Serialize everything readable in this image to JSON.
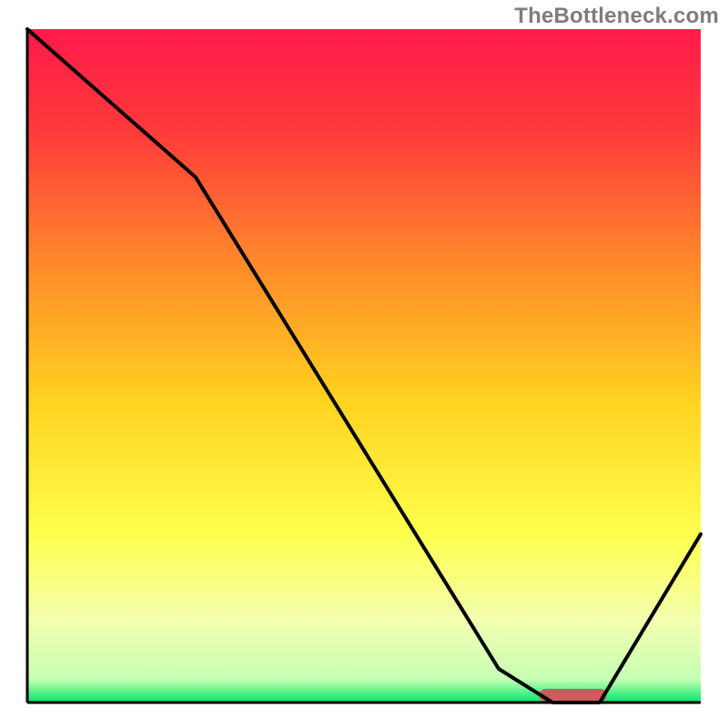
{
  "watermark": "TheBottleneck.com",
  "chart_data": {
    "type": "line",
    "title": "",
    "xlabel": "",
    "ylabel": "",
    "xlim": [
      0,
      100
    ],
    "ylim": [
      0,
      100
    ],
    "background_gradient": {
      "stops": [
        {
          "pos": 0.0,
          "color": "#ff1a4b"
        },
        {
          "pos": 0.15,
          "color": "#ff3a3a"
        },
        {
          "pos": 0.35,
          "color": "#ff8a2a"
        },
        {
          "pos": 0.55,
          "color": "#ffd21f"
        },
        {
          "pos": 0.75,
          "color": "#ffff4d"
        },
        {
          "pos": 0.88,
          "color": "#f2ffb0"
        },
        {
          "pos": 0.965,
          "color": "#c6ffb3"
        },
        {
          "pos": 1.0,
          "color": "#00e66b"
        }
      ]
    },
    "series": [
      {
        "name": "bottleneck-curve",
        "x": [
          0,
          25,
          70,
          78,
          85,
          100
        ],
        "y": [
          100,
          78,
          5,
          0,
          0,
          25
        ]
      }
    ],
    "marker": {
      "name": "optimal-range",
      "x_center": 81,
      "width": 10,
      "color": "#cc5c5c"
    },
    "axes": {
      "show_ticks": false,
      "show_grid": false,
      "border_color": "#000000",
      "border_width": 3
    }
  }
}
